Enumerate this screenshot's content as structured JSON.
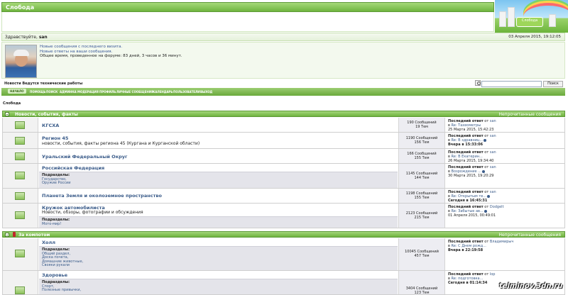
{
  "header": {
    "title": "Слобода"
  },
  "logo": {
    "sign": "Слобода"
  },
  "greeting": {
    "prefix": "Здравствуйте,",
    "user": "san",
    "date": "03 Апреля 2015, 19:12:05"
  },
  "user_panel": {
    "new_posts": "Новые сообщения с последнего визита.",
    "new_replies": "Новые ответы на ваши сообщения.",
    "time_online": "Общее время, проведенное на форуме: 83 дней, 3 часов и 36 минут."
  },
  "links_row": {
    "text": "Новости   Ведутся технические работы"
  },
  "search": {
    "button": "Поиск",
    "value": ""
  },
  "nav": {
    "items": [
      "НАЧАЛО",
      "ПОМОЩЬ",
      "ПОИСК",
      "АДМИНКА",
      "МОДЕРАЦИЯ",
      "ПРОФИЛЬ",
      "ЛИЧНЫЕ СООБЩЕНИЯ",
      "КАЛЕНДАРЬ",
      "ПОЛЬЗОВАТЕЛИ",
      "ВЫХОД"
    ]
  },
  "breadcrumb": "Слобода",
  "categories": [
    {
      "name": "Новости, события, факты",
      "unread": "Непрочитанные сообщения",
      "forums": [
        {
          "name": "КГСХА",
          "desc": "",
          "posts": "190 Сообщений",
          "topics": "19 Тем",
          "last_label": "Последний ответ",
          "last_by": "от",
          "last_user": "san",
          "last_in": "в",
          "last_topic": "Re: Тахеометры",
          "last_date": "25 Марта 2015, 15:42:23"
        },
        {
          "name": "Регион 45",
          "desc": "новости, события, факты региона 45 (Кургана и Курганской области)",
          "posts": "1190 Сообщений",
          "topics": "156 Тем",
          "last_label": "Последний ответ",
          "last_by": "от",
          "last_user": "san",
          "last_in": "в",
          "last_topic": "Re: В здравниц...",
          "last_date": "Вчера в 15:33:06"
        },
        {
          "name": "Уральский Федеральный Округ",
          "desc": "",
          "posts": "166 Сообщений",
          "topics": "155 Тем",
          "last_label": "Последний ответ",
          "last_by": "от",
          "last_user": "san",
          "last_in": "в",
          "last_topic": "Re: В Екатерин...",
          "last_date": "26 Марта 2015, 19:34:40"
        },
        {
          "name": "Российская Федерация",
          "desc": "",
          "posts": "1145 Сообщений",
          "topics": "144 Тем",
          "subs_label": "Подразделы:",
          "subs": [
            "Государство,",
            "Оружие России"
          ],
          "last_label": "Последний ответ",
          "last_by": "от",
          "last_user": "san",
          "last_in": "в",
          "last_topic": "Возрождение ...",
          "last_date": "30 Марта 2015, 19:20:29"
        },
        {
          "name": "Планета Земля и околоземное пространство",
          "desc": "",
          "posts": "1198 Сообщений",
          "topics": "155 Тем",
          "last_label": "Последний ответ",
          "last_by": "от",
          "last_user": "san",
          "last_in": "в",
          "last_topic": "Re: Открытым те...",
          "last_date": "Сегодня в 16:45:31"
        },
        {
          "name": "Кружок автомобилиста",
          "desc": "Новости, обзоры, фотографии и обсуждения",
          "posts": "2123 Сообщений",
          "topics": "215 Тем",
          "subs_label": "Подразделы:",
          "subs": [
            "Мото-мир!"
          ],
          "last_label": "Последний ответ",
          "last_by": "от",
          "last_user": "Dodgelt",
          "last_in": "в",
          "last_topic": "Re: Забытые ав...",
          "last_date": "01 Апреля 2015, 00:49:01"
        }
      ]
    },
    {
      "name": "За компотом",
      "unread": "Непрочитанные сообщения",
      "forums": [
        {
          "name": "Холл",
          "desc": "",
          "posts": "10045 Сообщений",
          "topics": "457 Тем",
          "subs_label": "Подразделы:",
          "subs": [
            "Общий раздел,",
            "Доска почета,",
            "Домашние животные,",
            "Свояки рукали"
          ],
          "last_label": "Последний ответ",
          "last_by": "от",
          "last_user": "Владимирыч",
          "last_in": "в",
          "last_topic": "Re: С Днем рожд...",
          "last_date": "Вчера в 22:19:58"
        },
        {
          "name": "Здоровье",
          "desc": "",
          "posts": "3404 Сообщений",
          "topics": "123 Тем",
          "subs_label": "Подразделы:",
          "subs": [
            "Спорт,",
            "Полезные привычки,"
          ],
          "last_label": "Последний ответ",
          "last_by": "от",
          "last_user": "lop",
          "last_in": "в",
          "last_topic": "Re: подготовка...",
          "last_date": "Сегодня в 01:14:34"
        }
      ]
    }
  ],
  "watermark": "telminov.3dn.ru",
  "colors": {
    "accent_green": "#6fb43f",
    "link_blue": "#3b5c8a",
    "row_grey": "#f2f2f2"
  }
}
